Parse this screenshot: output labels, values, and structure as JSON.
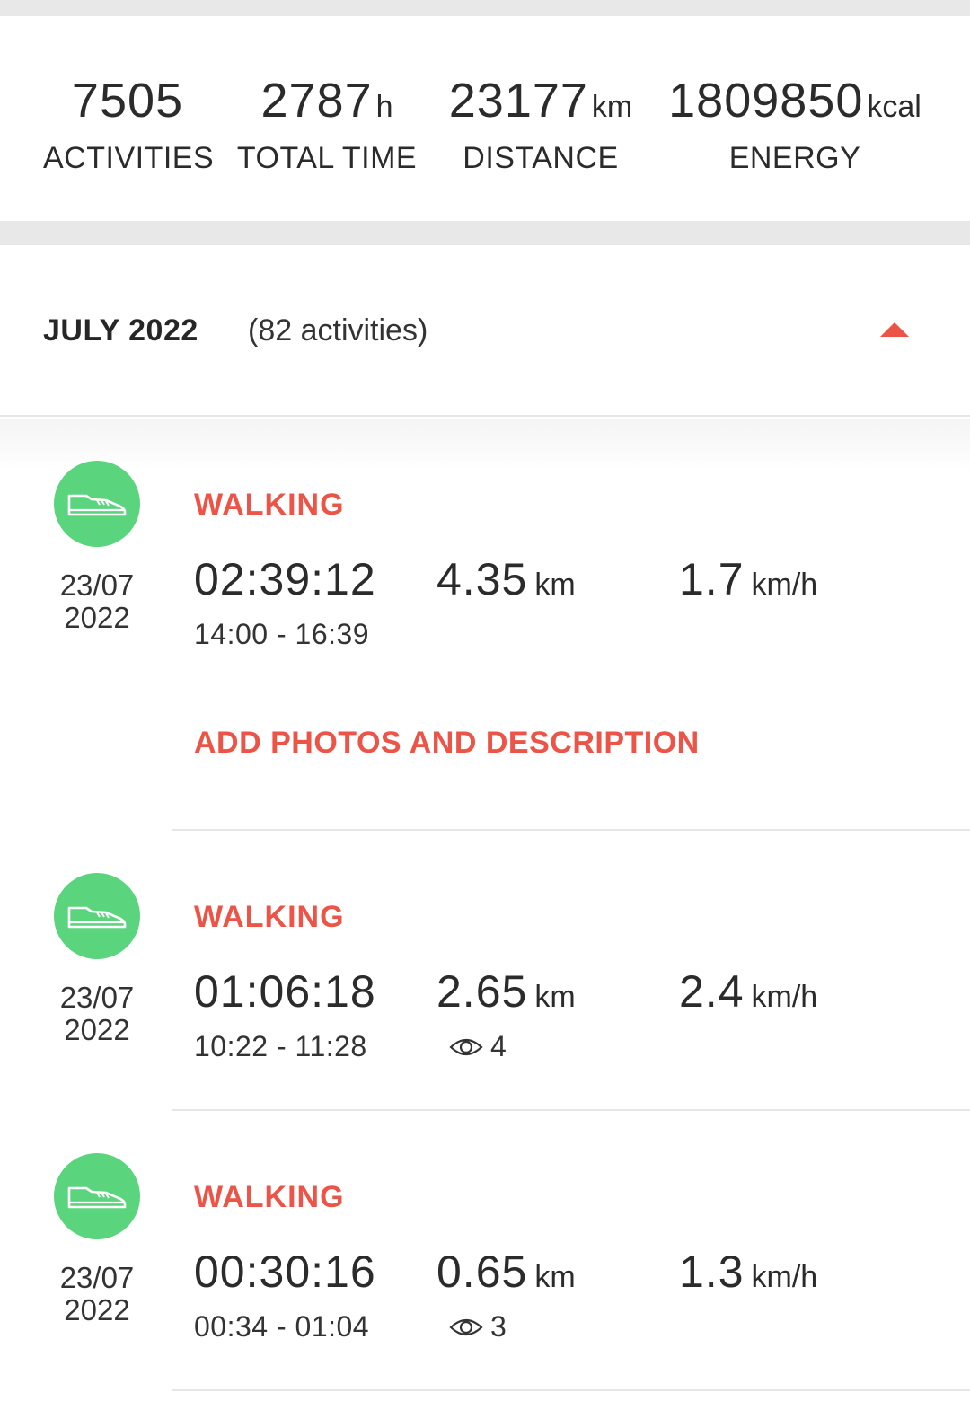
{
  "summary": {
    "activities": {
      "value": "7505",
      "unit": "",
      "label": "ACTIVITIES"
    },
    "total_time": {
      "value": "2787",
      "unit": "h",
      "label": "TOTAL TIME"
    },
    "distance": {
      "value": "23177",
      "unit": "km",
      "label": "DISTANCE"
    },
    "energy": {
      "value": "1809850",
      "unit": "kcal",
      "label": "ENERGY"
    }
  },
  "month": {
    "title": "JULY 2022",
    "count": "(82 activities)",
    "expanded": true
  },
  "colors": {
    "accent": "#ec5448",
    "walking_icon_bg": "#5ad47d"
  },
  "activities": [
    {
      "icon": "shoe-icon",
      "date_line1": "23/07",
      "date_line2": "2022",
      "type": "WALKING",
      "duration": "02:39:12",
      "time_range": "14:00 - 16:39",
      "distance": "4.35",
      "distance_unit": "km",
      "speed": "1.7",
      "speed_unit": "km/h",
      "add_link": "ADD PHOTOS AND DESCRIPTION"
    },
    {
      "icon": "shoe-icon",
      "date_line1": "23/07",
      "date_line2": "2022",
      "type": "WALKING",
      "duration": "01:06:18",
      "time_range": "10:22 - 11:28",
      "distance": "2.65",
      "distance_unit": "km",
      "speed": "2.4",
      "speed_unit": "km/h",
      "views": "4"
    },
    {
      "icon": "shoe-icon",
      "date_line1": "23/07",
      "date_line2": "2022",
      "type": "WALKING",
      "duration": "00:30:16",
      "time_range": "00:34 - 01:04",
      "distance": "0.65",
      "distance_unit": "km",
      "speed": "1.3",
      "speed_unit": "km/h",
      "views": "3"
    }
  ]
}
